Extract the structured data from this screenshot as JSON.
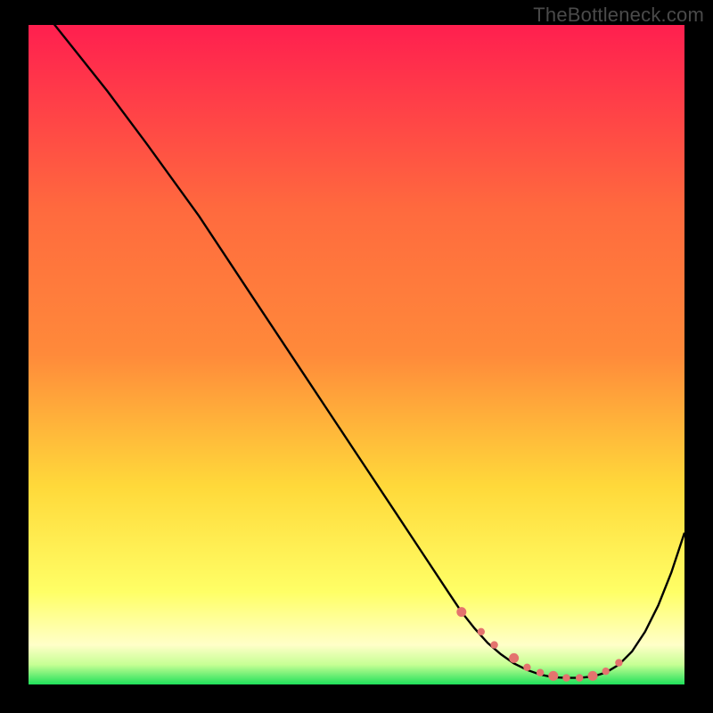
{
  "watermark": "TheBottleneck.com",
  "colors": {
    "grad_top": "#ff1f4f",
    "grad_upper_mid": "#ff8a3a",
    "grad_mid": "#ffd93a",
    "grad_lower": "#ffff66",
    "grad_bottom_fade": "#ffffc8",
    "grad_green": "#1fe05a",
    "curve": "#000000",
    "marker": "#e4736e",
    "frame_bg": "#000000"
  },
  "chart_data": {
    "type": "line",
    "title": "",
    "xlabel": "",
    "ylabel": "",
    "xlim": [
      0,
      100
    ],
    "ylim": [
      0,
      100
    ],
    "series": [
      {
        "name": "bottleneck-curve",
        "x": [
          0,
          4,
          8,
          12,
          18,
          26,
          34,
          42,
          50,
          56,
          60,
          64,
          66,
          68,
          70,
          72,
          74,
          76,
          78,
          80,
          82,
          84,
          86,
          88,
          90,
          92,
          94,
          96,
          98,
          100
        ],
        "y": [
          105,
          100,
          95,
          90,
          82,
          71,
          59,
          47,
          35,
          26,
          20,
          14,
          11,
          8.5,
          6.3,
          4.6,
          3.2,
          2.2,
          1.5,
          1.1,
          1.0,
          1.0,
          1.2,
          1.8,
          3.0,
          5.0,
          8.0,
          12.0,
          17.0,
          23.0
        ]
      }
    ],
    "markers": {
      "name": "highlight-cluster",
      "x": [
        66,
        69,
        71,
        74,
        76,
        78,
        80,
        82,
        84,
        86,
        88,
        90
      ],
      "y": [
        11,
        8,
        6,
        4,
        2.6,
        1.8,
        1.3,
        1.0,
        1.0,
        1.3,
        2.0,
        3.3
      ]
    }
  }
}
